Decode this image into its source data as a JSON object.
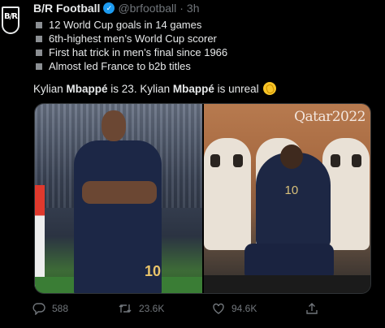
{
  "tweet": {
    "avatar_text": "B/R",
    "author_name": "B/R Football",
    "verified_icon": "verified-badge-icon",
    "handle": "@brfootball",
    "separator": "·",
    "time": "3h",
    "bullets": [
      "12 World Cup goals in 14 games",
      "6th-highest men’s World Cup scorer",
      "First hat trick in men’s final since 1966",
      "Almost led France to b2b titles"
    ],
    "body": {
      "part1": "Kylian ",
      "bold1": "Mbappé",
      "part2": " is 23. Kylian ",
      "bold2": "Mbappé",
      "part3": " is unreal",
      "emoji_icon": "clapping-hands-icon"
    },
    "media": {
      "left_jersey_number": "10",
      "right_jersey_number": "10",
      "right_branding": "Qatar2022"
    },
    "actions": {
      "replies": "588",
      "retweets": "23.6K",
      "likes": "94.6K"
    },
    "colors": {
      "accent": "#1d9bf0",
      "text": "#e7e9ea",
      "muted": "#71767b",
      "background": "#000000"
    }
  }
}
